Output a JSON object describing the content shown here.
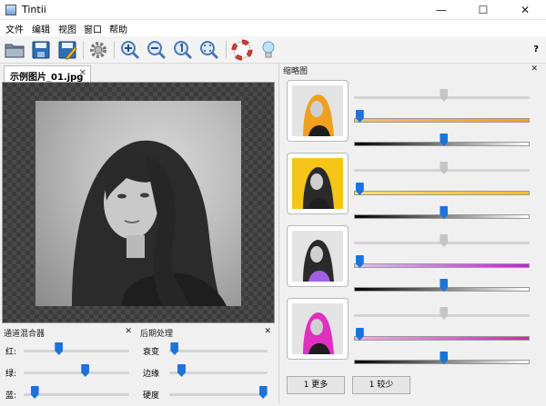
{
  "window": {
    "title": "Tintii",
    "minimize": "—",
    "maximize": "☐",
    "close": "✕"
  },
  "menu": [
    "文件",
    "编辑",
    "视图",
    "窗口",
    "帮助"
  ],
  "toolbar": {
    "help": "?"
  },
  "document": {
    "tab_label": "示例图片_01.jpg",
    "tab_close": "✕"
  },
  "mixer": {
    "title": "通道混合器",
    "close": "✕",
    "rows": [
      {
        "label": "红:",
        "value": 0.33
      },
      {
        "label": "绿:",
        "value": 0.58
      },
      {
        "label": "蓝:",
        "value": 0.1
      }
    ]
  },
  "post": {
    "title": "后期处理",
    "close": "✕",
    "rows": [
      {
        "label": "衰变",
        "value": 0.05
      },
      {
        "label": "边缘",
        "value": 0.12
      },
      {
        "label": "硬度",
        "value": 0.95
      }
    ]
  },
  "thumbnails": {
    "title": "缩略图",
    "close": "✕",
    "items": [
      {
        "accent": "#f0a020",
        "gradient": "linear-gradient(to right,#e8c27a,#f0a020)",
        "hue_pos": 0.51,
        "sat_pos": 0.03,
        "val_pos": 0.51
      },
      {
        "accent": "#f5c518",
        "gradient": "linear-gradient(to right,#f3dc7f,#f0c020)",
        "hue_pos": 0.51,
        "sat_pos": 0.03,
        "val_pos": 0.51
      },
      {
        "accent": "#a060e0",
        "gradient": "linear-gradient(to right,#d9c7ee,#c020d0)",
        "hue_pos": 0.51,
        "sat_pos": 0.03,
        "val_pos": 0.51
      },
      {
        "accent": "#e030c0",
        "gradient": "linear-gradient(to right,#f0b0dd,#d820b8)",
        "hue_pos": 0.51,
        "sat_pos": 0.03,
        "val_pos": 0.51
      }
    ],
    "more_button": "1 更多",
    "fewer_button": "1 较少"
  }
}
